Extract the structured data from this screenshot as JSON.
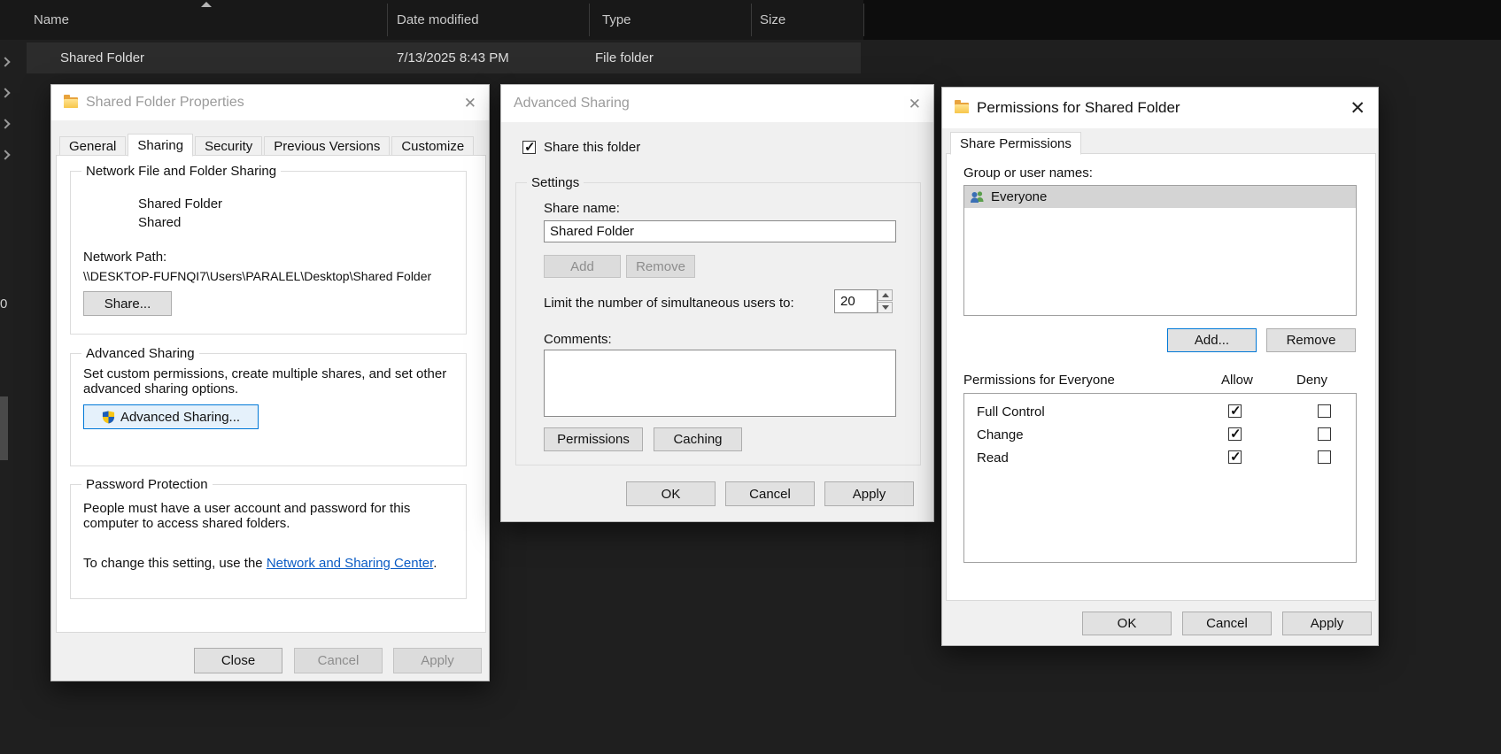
{
  "explorer": {
    "columns": [
      "Name",
      "Date modified",
      "Type",
      "Size"
    ],
    "row": {
      "name": "Shared Folder",
      "date_modified": "7/13/2025 8:43 PM",
      "type": "File folder",
      "size": ""
    },
    "left_label": "0"
  },
  "properties_dialog": {
    "title": "Shared Folder Properties",
    "tabs": [
      "General",
      "Sharing",
      "Security",
      "Previous Versions",
      "Customize"
    ],
    "network_group": {
      "title": "Network File and Folder Sharing",
      "folder_name": "Shared Folder",
      "folder_state": "Shared",
      "network_path_label": "Network Path:",
      "network_path": "\\\\DESKTOP-FUFNQI7\\Users\\PARALEL\\Desktop\\Shared Folder",
      "share_button": "Share..."
    },
    "advanced_group": {
      "title": "Advanced Sharing",
      "description": "Set custom permissions, create multiple shares, and set other advanced sharing options.",
      "button": "Advanced Sharing..."
    },
    "password_group": {
      "title": "Password Protection",
      "description": "People must have a user account and password for this computer to access shared folders.",
      "change_prefix": "To change this setting, use the ",
      "link": "Network and Sharing Center",
      "change_suffix": "."
    },
    "buttons": {
      "close": "Close",
      "cancel": "Cancel",
      "apply": "Apply"
    }
  },
  "advanced_dialog": {
    "title": "Advanced Sharing",
    "share_checkbox_label": "Share this folder",
    "share_checkbox_checked": true,
    "settings_group": {
      "title": "Settings",
      "share_name_label": "Share name:",
      "share_name_value": "Shared Folder",
      "add_button": "Add",
      "remove_button": "Remove",
      "limit_label": "Limit the number of simultaneous users to:",
      "limit_value": "20",
      "comments_label": "Comments:",
      "comments_value": "",
      "permissions_button": "Permissions",
      "caching_button": "Caching"
    },
    "buttons": {
      "ok": "OK",
      "cancel": "Cancel",
      "apply": "Apply"
    }
  },
  "permissions_dialog": {
    "title": "Permissions for Shared Folder",
    "tab": "Share Permissions",
    "group_label": "Group or user names:",
    "groups": [
      {
        "name": "Everyone"
      }
    ],
    "add_button": "Add...",
    "remove_button": "Remove",
    "permissions_label": "Permissions for Everyone",
    "allow_header": "Allow",
    "deny_header": "Deny",
    "permissions": [
      {
        "name": "Full Control",
        "allow": true,
        "deny": false
      },
      {
        "name": "Change",
        "allow": true,
        "deny": false
      },
      {
        "name": "Read",
        "allow": true,
        "deny": false
      }
    ],
    "buttons": {
      "ok": "OK",
      "cancel": "Cancel",
      "apply": "Apply"
    }
  }
}
